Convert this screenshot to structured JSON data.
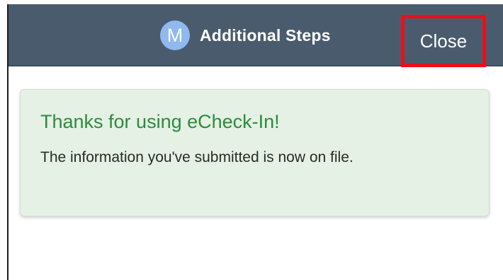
{
  "header": {
    "avatar_letter": "M",
    "title": "Additional Steps",
    "close_label": "Close"
  },
  "message": {
    "title": "Thanks for using eCheck-In!",
    "body": "The information you've submitted is now on file."
  },
  "colors": {
    "header_bg": "#4b5b6e",
    "avatar_bg": "#8fb9ef",
    "highlight_border": "#e8101a",
    "card_bg": "#e4f1e4",
    "success_text": "#2e8b3e"
  }
}
